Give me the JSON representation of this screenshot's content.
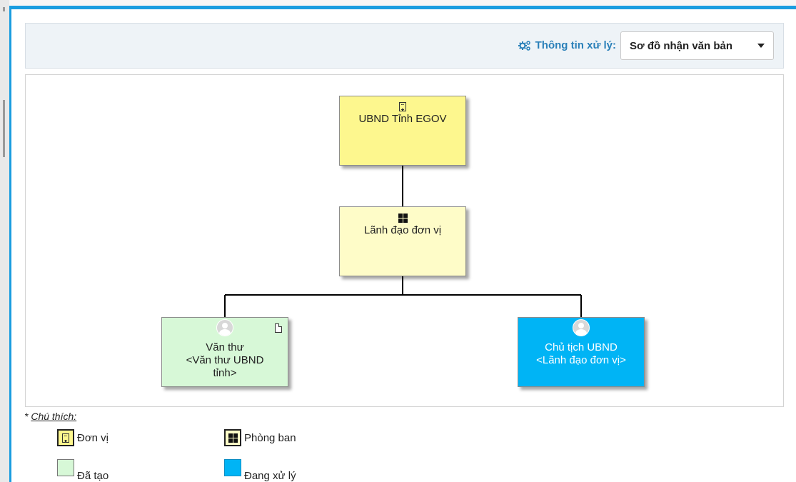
{
  "header": {
    "info_label": "Thông tin xử lý:",
    "dropdown_value": "Sơ đồ nhận văn bản",
    "accent_color": "#2a80b9"
  },
  "diagram": {
    "nodes": [
      {
        "id": "unit",
        "icon": "building-icon",
        "lines": [
          "UBND Tỉnh EGOV"
        ],
        "color": "#fdf78e"
      },
      {
        "id": "dept",
        "icon": "windows-icon",
        "lines": [
          "Lãnh đạo đơn vị"
        ],
        "color": "#fefcc8"
      },
      {
        "id": "clerk",
        "icon": "user-avatar-icon",
        "lines": [
          "Văn thư",
          "<Văn thư UBND",
          "tỉnh>"
        ],
        "color": "#d7f8d7",
        "badge_icon": "document-icon"
      },
      {
        "id": "chair",
        "icon": "user-avatar-icon",
        "lines": [
          "Chủ tịch UBND",
          "<Lãnh đạo đơn vị>"
        ],
        "color": "#00b4f5"
      }
    ]
  },
  "legend": {
    "prefix": "* ",
    "title": "Chú thích:",
    "items": [
      {
        "label": "Đơn vị",
        "icon": "building-icon",
        "color": "#fdf78e"
      },
      {
        "label": "Phòng ban",
        "icon": "windows-icon",
        "color": "#fefcc8"
      },
      {
        "label": "Đã tạo",
        "color": "#d7f8d7"
      },
      {
        "label": "Đang xử lý",
        "color": "#00b4f5"
      }
    ]
  }
}
